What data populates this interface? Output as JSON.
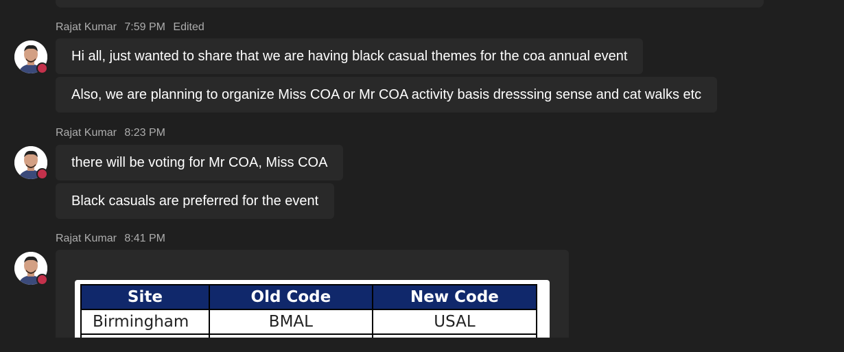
{
  "messages": [
    {
      "author": "Rajat Kumar",
      "time": "7:59 PM",
      "edited": "Edited",
      "lines": [
        "Hi all, just wanted to share that we are having black casual themes for the coa annual event",
        "Also, we are planning to organize Miss COA or Mr COA activity basis dresssing sense and cat walks etc"
      ]
    },
    {
      "author": "Rajat Kumar",
      "time": "8:23 PM",
      "lines": [
        "there will be voting for Mr COA, Miss COA",
        "Black casuals are preferred for the event"
      ]
    },
    {
      "author": "Rajat Kumar",
      "time": "8:41 PM",
      "image_table": {
        "headers": [
          "Site",
          "Old Code",
          "New Code"
        ],
        "rows": [
          [
            "Birmingham",
            "BMAL",
            "USAL"
          ]
        ]
      }
    }
  ],
  "presence_status": "busy-dot-icon",
  "colors": {
    "background": "#1f1f1f",
    "bubble": "#292929",
    "presence": "#c4314b",
    "table_header": "#10286b"
  }
}
